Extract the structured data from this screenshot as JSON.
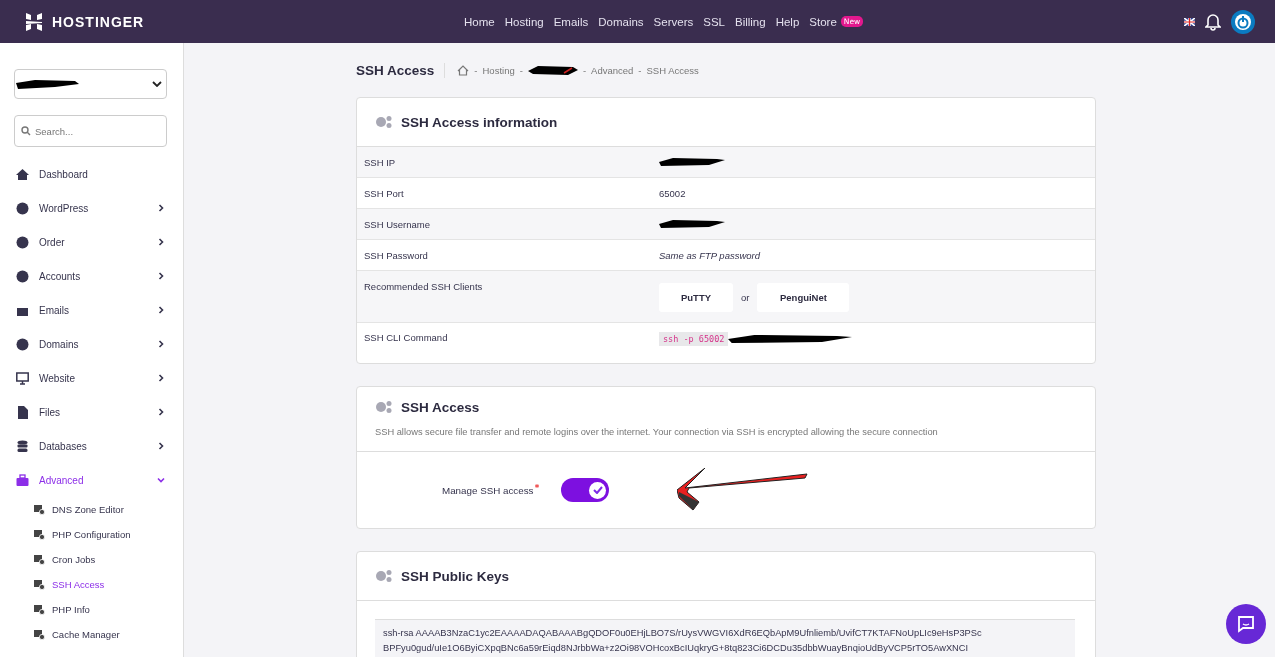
{
  "topbar": {
    "logo": "HOSTINGER",
    "nav": [
      {
        "label": "Home"
      },
      {
        "label": "Hosting"
      },
      {
        "label": "Emails"
      },
      {
        "label": "Domains"
      },
      {
        "label": "Servers"
      },
      {
        "label": "SSL"
      },
      {
        "label": "Billing"
      },
      {
        "label": "Help"
      },
      {
        "label": "Store",
        "badge": "New"
      }
    ]
  },
  "sidebar": {
    "account_select": {
      "redacted": true
    },
    "search": {
      "placeholder": "Search..."
    },
    "items": [
      {
        "label": "Dashboard",
        "selected": false
      },
      {
        "label": "WordPress",
        "selected": false,
        "expanded": false
      },
      {
        "label": "Order",
        "selected": false,
        "expanded": false
      },
      {
        "label": "Accounts",
        "selected": false,
        "expanded": false
      },
      {
        "label": "Emails",
        "selected": false,
        "expanded": false
      },
      {
        "label": "Domains",
        "selected": false,
        "expanded": false
      },
      {
        "label": "Website",
        "selected": false,
        "expanded": false
      },
      {
        "label": "Files",
        "selected": false,
        "expanded": false
      },
      {
        "label": "Databases",
        "selected": false,
        "expanded": false
      },
      {
        "label": "Advanced",
        "selected": true,
        "expanded": true,
        "children": [
          {
            "label": "DNS Zone Editor",
            "selected": false
          },
          {
            "label": "PHP Configuration",
            "selected": false
          },
          {
            "label": "Cron Jobs",
            "selected": false
          },
          {
            "label": "SSH Access",
            "selected": true
          },
          {
            "label": "PHP Info",
            "selected": false
          },
          {
            "label": "Cache Manager",
            "selected": false
          }
        ]
      }
    ]
  },
  "page": {
    "title": "SSH Access",
    "separator": "-",
    "breadcrumb": [
      {
        "label": "Hosting"
      },
      {
        "redacted": true
      },
      {
        "label": "Advanced"
      },
      {
        "label": "SSH Access"
      }
    ]
  },
  "info_card": {
    "title": "SSH Access information",
    "rows": [
      {
        "kind": "text",
        "label": "SSH IP",
        "redacted": true
      },
      {
        "kind": "text",
        "label": "SSH Port",
        "value": "65002"
      },
      {
        "kind": "text",
        "label": "SSH Username",
        "redacted": true
      },
      {
        "kind": "italic",
        "label": "SSH Password",
        "value": "Same as FTP password"
      },
      {
        "kind": "clients",
        "label": "Recommended SSH Clients",
        "buttons": [
          "PuTTY",
          "PenguiNet"
        ],
        "separator": "or"
      },
      {
        "kind": "code",
        "label": "SSH CLI Command",
        "value": "ssh -p 65002",
        "redacted": true
      }
    ]
  },
  "access_card": {
    "title": "SSH Access",
    "description": "SSH allows secure file transfer and remote logins over the internet. Your connection via SSH is encrypted allowing the secure connection",
    "toggle": {
      "label": "Manage SSH access",
      "required": true,
      "on": true
    }
  },
  "keys_card": {
    "title": "SSH Public Keys",
    "key_lines": [
      "ssh-rsa AAAAB3NzaC1yc2EAAAADAQABAAABgQDOF0u0EHjLBO7S/rUysVWGVI6XdR6EQbApM9Ufnliemb/UvifCT7KTAFNoUpLIc9eHsP3PSc",
      "BPFyu0gud/uIe1O6ByiCXpqBNc6a59rEiqd8NJrbbWa+z2Oi98VOHcoxBcIUqkryG+8tq823Ci6DCDu35dbbWuayBnqioUdByVCP5rTO5AwXNCI"
    ]
  }
}
